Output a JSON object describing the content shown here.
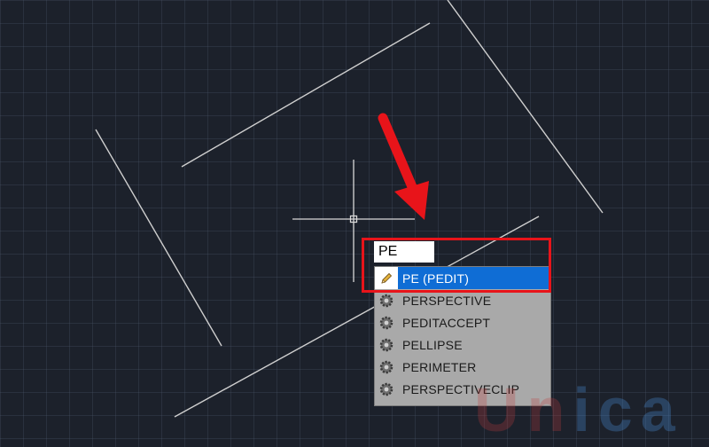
{
  "command": {
    "input_value": "PE",
    "suggestions": [
      {
        "label": "PE (PEDIT)",
        "icon": "pencil-icon",
        "selected": true
      },
      {
        "label": "PERSPECTIVE",
        "icon": "gear-icon",
        "selected": false
      },
      {
        "label": "PEDITACCEPT",
        "icon": "gear-icon",
        "selected": false
      },
      {
        "label": "PELLIPSE",
        "icon": "gear-icon",
        "selected": false
      },
      {
        "label": "PERIMETER",
        "icon": "gear-icon",
        "selected": false
      },
      {
        "label": "PERSPECTIVECLIP",
        "icon": "gear-icon",
        "selected": false
      }
    ]
  },
  "watermark": {
    "letters": [
      "U",
      "n",
      "i",
      "c",
      "a"
    ]
  },
  "colors": {
    "canvas_bg": "#1c212b",
    "selection": "#0f6dd5",
    "highlight": "#e8141a",
    "arrow": "#e8141a",
    "lines": "#cfcfcf"
  }
}
